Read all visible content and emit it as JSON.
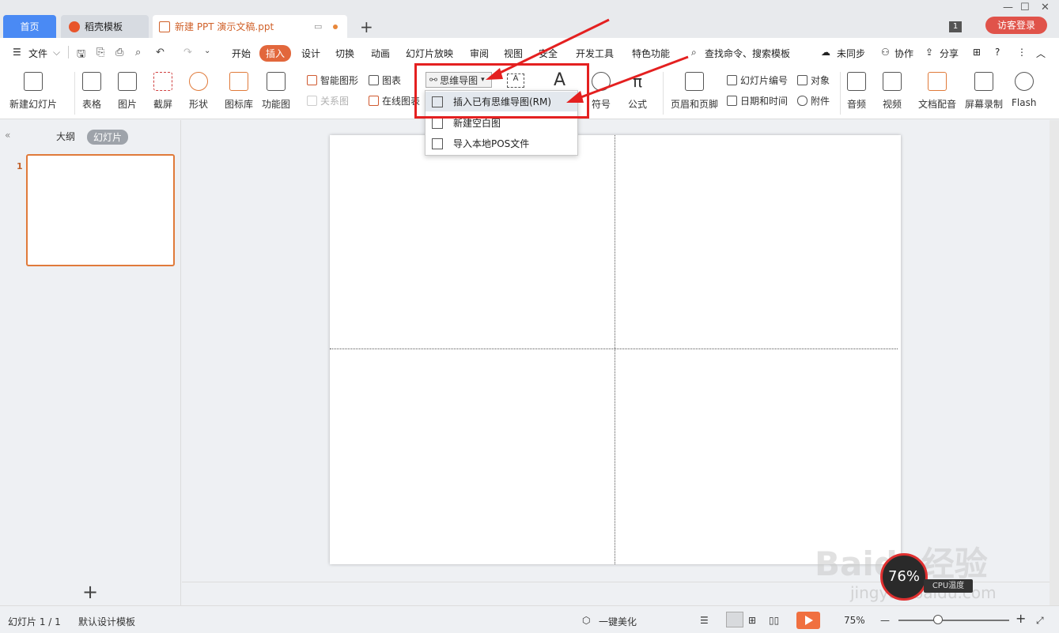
{
  "tabs": {
    "home": "首页",
    "store": "稻壳模板",
    "doc": "新建 PPT 演示文稿.ppt"
  },
  "header": {
    "page_badge": "1",
    "login": "访客登录"
  },
  "menu": {
    "file": "文件",
    "items": [
      "开始",
      "插入",
      "设计",
      "切换",
      "动画",
      "幻灯片放映",
      "审阅",
      "视图",
      "安全",
      "开发工具",
      "特色功能"
    ],
    "active": "插入",
    "search": "查找命令、搜索模板",
    "sync": "未同步",
    "collab": "协作",
    "share": "分享"
  },
  "ribbon": {
    "new_slide": "新建幻灯片",
    "table": "表格",
    "picture": "图片",
    "screenshot": "截屏",
    "shape": "形状",
    "icon_lib": "图标库",
    "func_chart": "功能图",
    "smart_art": "智能图形",
    "chart": "图表",
    "relation": "关系图",
    "online_chart": "在线图表",
    "mind_map": "思维导图",
    "symbol": "符号",
    "formula": "公式",
    "header_footer": "页眉和页脚",
    "slide_number": "幻灯片编号",
    "object": "对象",
    "datetime": "日期和时间",
    "attachment": "附件",
    "audio": "音频",
    "video": "视频",
    "doc_dub": "文档配音",
    "screen_rec": "屏幕录制",
    "flash": "Flash"
  },
  "dropdown": {
    "items": [
      "插入已有思维导图(RM)",
      "新建空白图",
      "导入本地POS文件"
    ]
  },
  "left_panel": {
    "outline": "大纲",
    "slides": "幻灯片",
    "slide_num": "1"
  },
  "status": {
    "slide_count": "幻灯片 1 / 1",
    "template": "默认设计模板",
    "beautify": "一键美化",
    "zoom": "75%"
  },
  "overlay": {
    "cpu_percent": "76%",
    "cpu_label": "CPU温度",
    "watermark": "Baidu经验",
    "watermark_url": "jingyan.baidu.com"
  }
}
